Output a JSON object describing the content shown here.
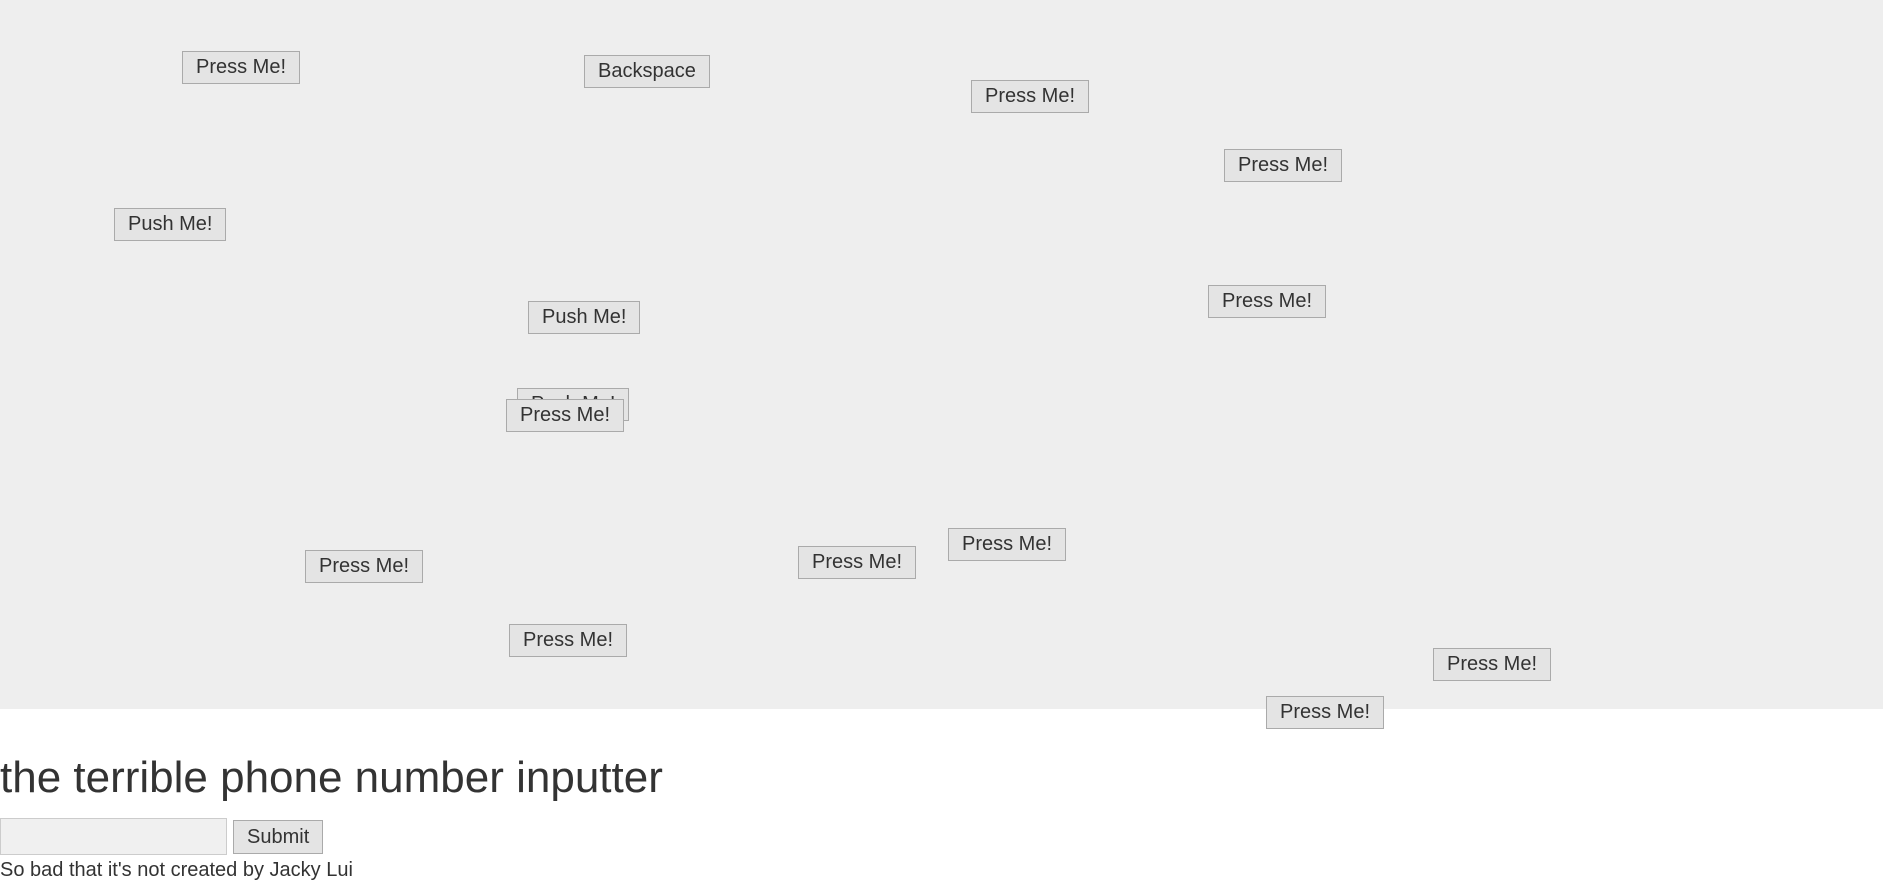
{
  "playfield": {
    "buttons": [
      {
        "label": "Press Me!"
      },
      {
        "label": "Backspace"
      },
      {
        "label": "Press Me!"
      },
      {
        "label": "Press Me!"
      },
      {
        "label": "Push Me!"
      },
      {
        "label": "Push Me!"
      },
      {
        "label": "Press Me!"
      },
      {
        "label": "Push Me!"
      },
      {
        "label": "Press Me!"
      },
      {
        "label": "Press Me!"
      },
      {
        "label": "Press Me!"
      },
      {
        "label": "Press Me!"
      },
      {
        "label": "Press Me!"
      },
      {
        "label": "Press Me!"
      },
      {
        "label": "Press Me!"
      }
    ]
  },
  "header": {
    "title": "the terrible phone number inputter"
  },
  "form": {
    "phone_value": "",
    "phone_placeholder": "",
    "submit_label": "Submit"
  },
  "footer": {
    "note": "So bad that it's not created by Jacky Lui"
  }
}
